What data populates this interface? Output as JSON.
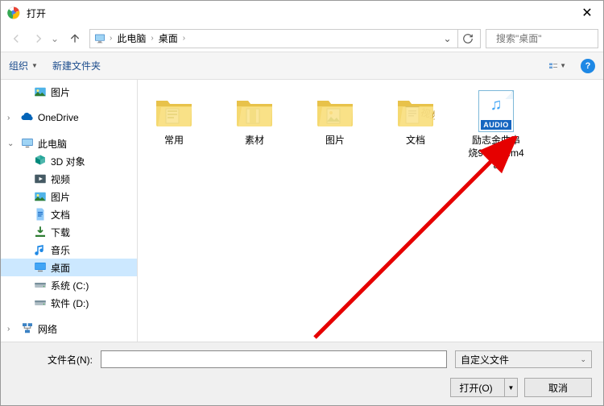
{
  "window": {
    "title": "打开"
  },
  "breadcrumb": {
    "items": [
      "此电脑",
      "桌面"
    ]
  },
  "search": {
    "placeholder": "搜索\"桌面\""
  },
  "toolbar": {
    "organize": "组织",
    "new_folder": "新建文件夹"
  },
  "sidebar": {
    "items": [
      {
        "label": "图片",
        "depth": 1,
        "icon": "pictures",
        "selected": false
      },
      {
        "label": "OneDrive",
        "depth": 0,
        "icon": "onedrive",
        "selected": false
      },
      {
        "label": "此电脑",
        "depth": 0,
        "icon": "pc",
        "selected": false
      },
      {
        "label": "3D 对象",
        "depth": 1,
        "icon": "3d",
        "selected": false
      },
      {
        "label": "视频",
        "depth": 1,
        "icon": "video",
        "selected": false
      },
      {
        "label": "图片",
        "depth": 1,
        "icon": "pictures",
        "selected": false
      },
      {
        "label": "文档",
        "depth": 1,
        "icon": "docs",
        "selected": false
      },
      {
        "label": "下载",
        "depth": 1,
        "icon": "downloads",
        "selected": false
      },
      {
        "label": "音乐",
        "depth": 1,
        "icon": "music",
        "selected": false
      },
      {
        "label": "桌面",
        "depth": 1,
        "icon": "desktop",
        "selected": true
      },
      {
        "label": "系统 (C:)",
        "depth": 1,
        "icon": "drive",
        "selected": false
      },
      {
        "label": "软件 (D:)",
        "depth": 1,
        "icon": "drive",
        "selected": false
      },
      {
        "label": "网络",
        "depth": 0,
        "icon": "network",
        "selected": false
      }
    ]
  },
  "files": [
    {
      "label": "常用",
      "type": "folder"
    },
    {
      "label": "素材",
      "type": "folder"
    },
    {
      "label": "图片",
      "type": "folder"
    },
    {
      "label": "文档",
      "type": "folder"
    },
    {
      "label": "励志金曲串烧90年代.m4a",
      "type": "audio",
      "tag": "AUDIO"
    }
  ],
  "footer": {
    "filename_label": "文件名(N):",
    "filter": "自定义文件",
    "open": "打开(O)",
    "cancel": "取消"
  }
}
